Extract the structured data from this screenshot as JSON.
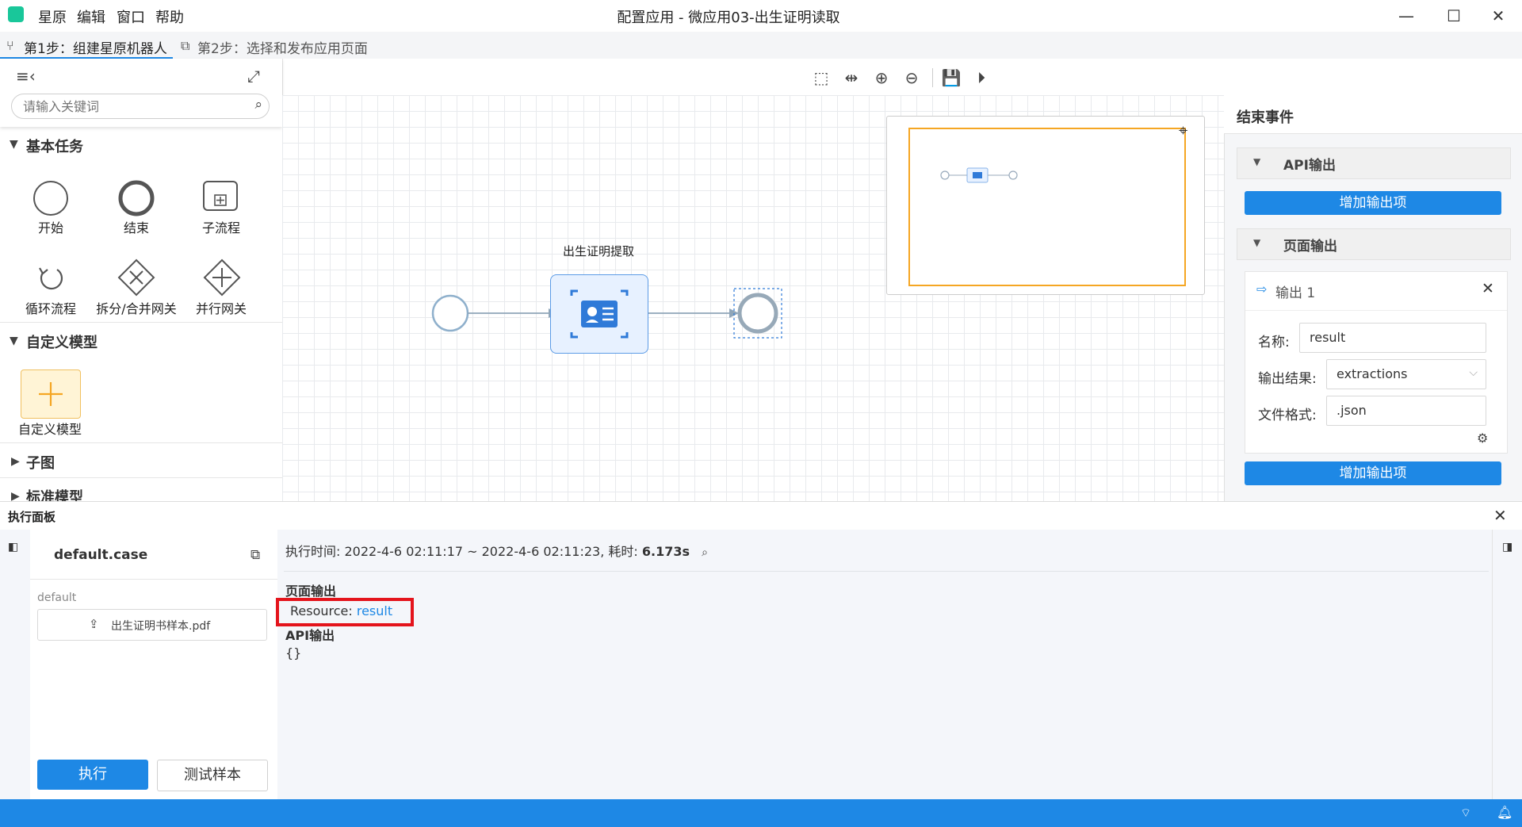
{
  "window": {
    "title": "配置应用 - 微应用03-出生证明读取",
    "menu": [
      "星原",
      "编辑",
      "窗口",
      "帮助"
    ]
  },
  "tabs": [
    {
      "label": "第1步：组建星原机器人"
    },
    {
      "label": "第2步：选择和发布应用页面"
    }
  ],
  "left_panel": {
    "search_placeholder": "请输入关键词",
    "sections": {
      "basic": "基本任务",
      "custom": "自定义模型",
      "subgraph": "子图",
      "standard": "标准模型"
    },
    "basic_items": [
      "开始",
      "结束",
      "子流程",
      "循环流程",
      "拆分/合并网关",
      "并行网关"
    ],
    "custom_items": [
      "自定义模型"
    ]
  },
  "canvas": {
    "task_label": "出生证明提取"
  },
  "right_panel": {
    "title": "结束事件",
    "api_section": "API输出",
    "add_output_1": "增加输出项",
    "page_section": "页面输出",
    "output_card_title": "输出 1",
    "name_label": "名称:",
    "name_value": "result",
    "result_label": "输出结果:",
    "result_value": "extractions",
    "format_label": "文件格式:",
    "format_value": ".json",
    "add_output_2": "增加输出项"
  },
  "exec_panel": {
    "title": "执行面板",
    "case_name": "default.case",
    "case_group": "default",
    "file_name": "出生证明书样本.pdf",
    "run_button": "执行",
    "test_button": "测试样本",
    "time_prefix": "执行时间: 2022-4-6 02:11:17 ~ 2022-4-6 02:11:23, 耗时: ",
    "duration": "6.173s",
    "page_output_title": "页面输出",
    "resource_label": "Resource: ",
    "resource_link": "result",
    "api_output_title": "API输出",
    "api_output_value": "{}"
  },
  "colors": {
    "accent": "#1e88e5",
    "highlight": "#e4141c",
    "minimap_frame": "#f5a623"
  }
}
